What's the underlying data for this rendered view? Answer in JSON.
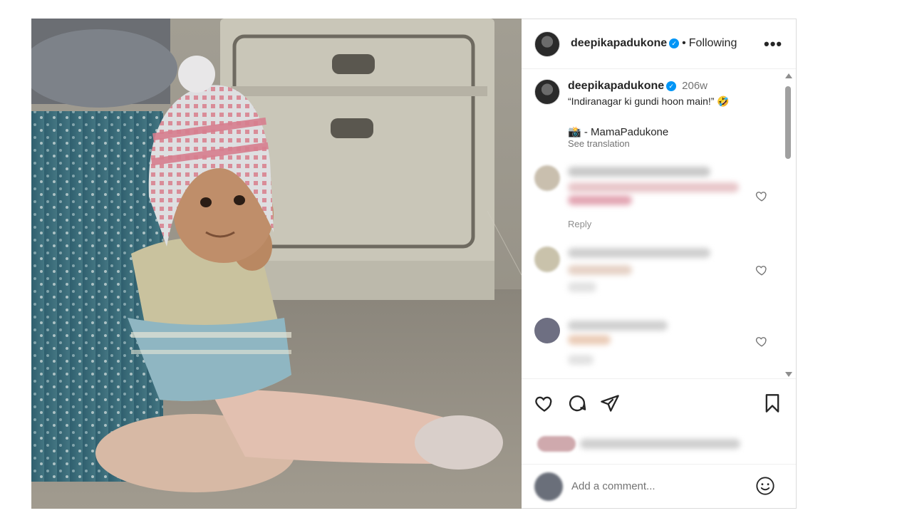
{
  "post": {
    "username": "deepikapadukone",
    "verified_mark": "✓",
    "follow_status": "Following",
    "separator": "•",
    "more_label": "•••"
  },
  "caption": {
    "username": "deepikapadukone",
    "time_ago": "206w",
    "text": "“Indiranagar ki gundi hoon main!” 🤣",
    "credit": "📸 - MamaPadukone",
    "see_translation": "See translation"
  },
  "comments": {
    "reply_label": "Reply"
  },
  "add_comment": {
    "placeholder": "Add a comment..."
  },
  "icons": {
    "like": "heart-icon",
    "comment": "comment-icon",
    "share": "send-icon",
    "save": "bookmark-icon",
    "emoji": "smiley-icon",
    "more": "more-options-icon"
  },
  "colors": {
    "verified_blue": "#0095f6",
    "text_primary": "#262626",
    "text_secondary": "#737373",
    "border": "#dbdbdb"
  }
}
